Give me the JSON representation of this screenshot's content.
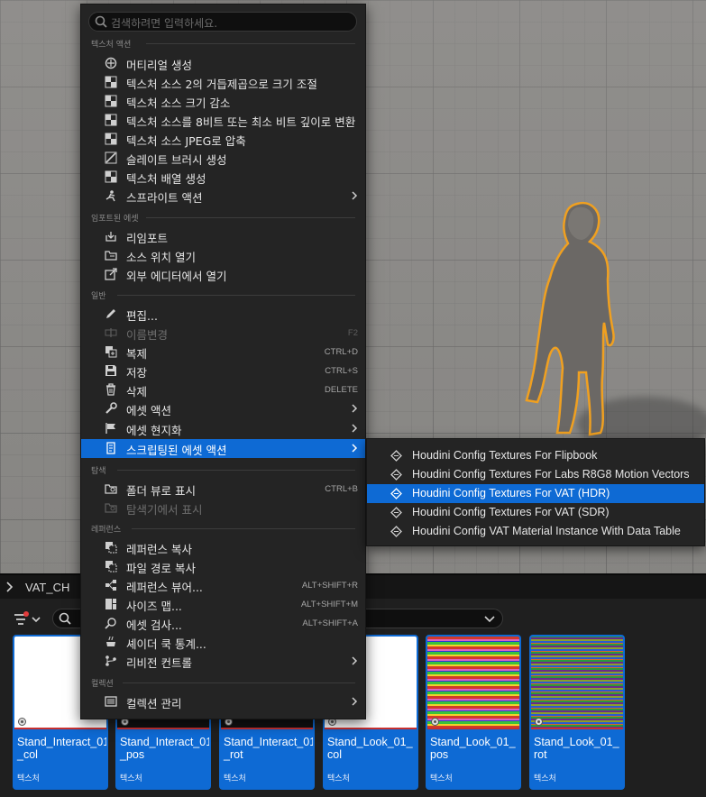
{
  "context_menu": {
    "search_placeholder": "검색하려면 입력하세요.",
    "sections": {
      "texture_actions": "텍스처 액션",
      "imported_asset": "임포트된 에셋",
      "general": "일반",
      "explore": "탐색",
      "references": "레퍼런스",
      "collections": "컬렉션"
    },
    "items": {
      "create_material": "머티리얼 생성",
      "resize_pow2": "텍스처 소스 2의 거듭제곱으로 크기 조절",
      "reduce_size": "텍스처 소스 크기 감소",
      "convert_bit_depth": "텍스처 소스를 8비트 또는 최소 비트 깊이로 변환",
      "compress_jpeg": "텍스처 소스 JPEG로 압축",
      "create_slate_brush": "슬레이트 브러시 생성",
      "create_texture_array": "텍스처 배열 생성",
      "sprite_actions": "스프라이트 액션",
      "reimport": "리임포트",
      "open_source_location": "소스 위치 열기",
      "open_external_editor": "외부 에디터에서 열기",
      "edit": "편집...",
      "rename": "이름변경",
      "rename_shortcut": "F2",
      "duplicate": "복제",
      "duplicate_shortcut": "CTRL+D",
      "save": "저장",
      "save_shortcut": "CTRL+S",
      "delete": "삭제",
      "delete_shortcut": "DELETE",
      "asset_actions": "에셋 액션",
      "asset_localization": "에셋 현지화",
      "scripted_asset_actions": "스크립팅된 에셋 액션",
      "show_folder_view": "폴더 뷰로 표시",
      "show_folder_view_shortcut": "CTRL+B",
      "show_in_explorer": "탐색기에서 표시",
      "copy_reference": "레퍼런스 복사",
      "copy_file_path": "파일 경로 복사",
      "reference_viewer": "레퍼런스 뷰어...",
      "reference_viewer_shortcut": "ALT+SHIFT+R",
      "size_map": "사이즈 맵...",
      "size_map_shortcut": "ALT+SHIFT+M",
      "audit_assets": "에셋 검사...",
      "audit_assets_shortcut": "ALT+SHIFT+A",
      "shader_cook_stats": "셰이더 쿡 통계...",
      "revision_control": "리비전 컨트롤",
      "manage_collections": "컬렉션 관리"
    }
  },
  "submenu": {
    "items": [
      "Houdini Config Textures For Flipbook",
      "Houdini Config Textures For Labs R8G8 Motion Vectors",
      "Houdini Config Textures For VAT (HDR)",
      "Houdini Config Textures For VAT (SDR)",
      "Houdini Config VAT Material Instance With Data Table"
    ],
    "active_index": 2
  },
  "content_browser": {
    "path": "VAT_CH",
    "assets": [
      {
        "name": "Stand_Interact_01\n_col",
        "type": "텍스처"
      },
      {
        "name": "Stand_Interact_01\n_pos",
        "type": "텍스처"
      },
      {
        "name": "Stand_Interact_01\n_rot",
        "type": "텍스처"
      },
      {
        "name": "Stand_Look_01_\ncol",
        "type": "텍스처"
      },
      {
        "name": "Stand_Look_01_\npos",
        "type": "텍스처"
      },
      {
        "name": "Stand_Look_01_\nrot",
        "type": "텍스처"
      }
    ]
  },
  "colors": {
    "accent": "#0e6ad4",
    "menu_bg": "#242424",
    "selection_outline": "#f0a020"
  }
}
